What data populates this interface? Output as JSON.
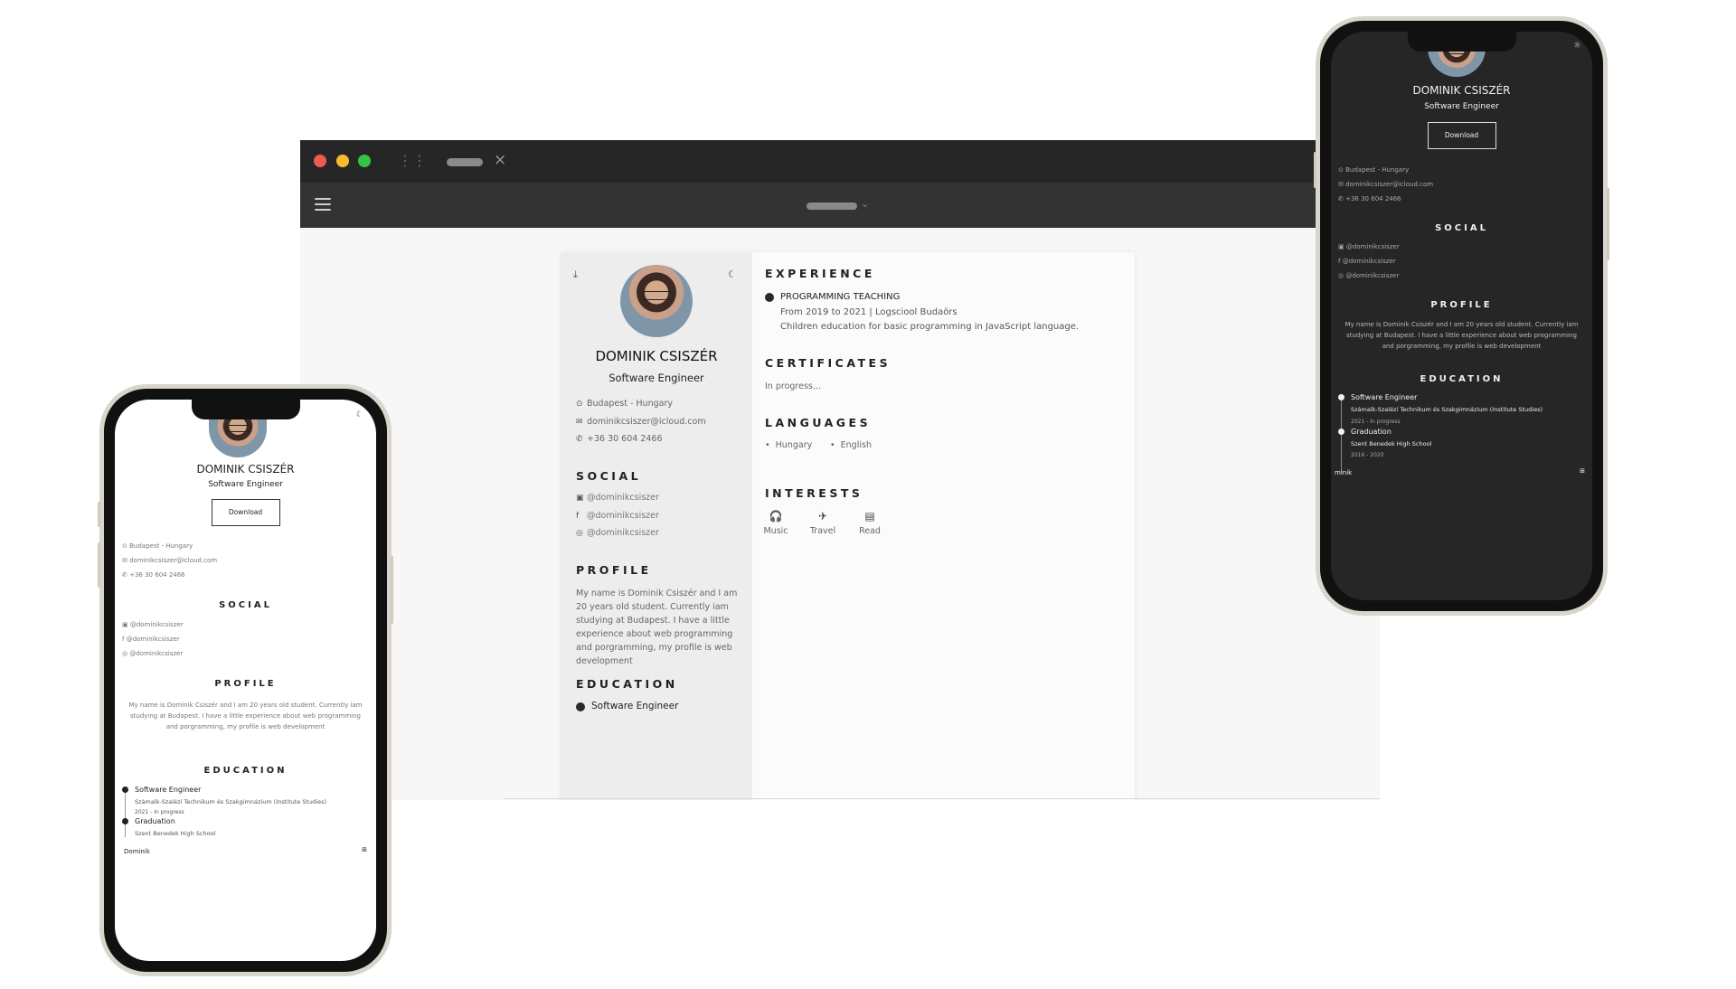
{
  "colors": {
    "titlebar": "#262626",
    "toolbar": "#333333",
    "close": "#ee5a52",
    "minimize": "#f5bd2e",
    "maximize": "#34c548",
    "dark_screen": "#262626",
    "light_screen": "#ffffff"
  },
  "browser": {
    "icons": [
      "close-dot",
      "minimize-dot",
      "maximize-dot",
      "figma-icon",
      "tab-close-icon",
      "menu-icon",
      "chevron-down-icon"
    ],
    "tab_close": "×",
    "url_chevron": "⌄"
  },
  "resume": {
    "name": "DOMINIK CSISZÉR",
    "role": "Software Engineer",
    "download_label": "Download",
    "location": "Budapest - Hungary",
    "email": "dominikcsiszer@icloud.com",
    "phone": "+36 30 604 2466",
    "sections": {
      "social": "SOCIAL",
      "profile": "PROFILE",
      "education": "EDUCATION",
      "experience": "EXPERIENCE",
      "certificates": "CERTIFICATES",
      "languages": "LANGUAGES",
      "interests": "INTERESTS"
    },
    "social": [
      {
        "icon": "linkedin-icon",
        "glyph": "▣",
        "handle": "@dominikcsiszer"
      },
      {
        "icon": "facebook-icon",
        "glyph": "f",
        "handle": "@dominikcsiszer"
      },
      {
        "icon": "instagram-icon",
        "glyph": "◎",
        "handle": "@dominikcsiszer"
      }
    ],
    "profile_text": "My name is Dominik Csiszér and I am 20 years old student. Currently iam studying at Budapest. I have a little experience about web programming and porgramming, my profile is web development",
    "education": [
      {
        "title": "Software Engineer",
        "school": "Számalk-Szalézi Technikum és Szakgimnázium (Institute Studies)",
        "dates": "2021 - In progress"
      },
      {
        "title": "Graduation",
        "school": "Szent Benedek High School",
        "dates": "2016 - 2020"
      }
    ],
    "experience": {
      "title": "PROGRAMMING TEACHING",
      "meta": "From 2019 to 2021 | Logsciool Budaörs",
      "desc": "Children education for basic programming in JavaScript language."
    },
    "certificates_text": "In progress...",
    "languages": [
      "Hungary",
      "English"
    ],
    "interests": [
      {
        "icon": "headphones-icon",
        "glyph": "🎧",
        "label": "Music"
      },
      {
        "icon": "airplane-icon",
        "glyph": "✈",
        "label": "Travel"
      },
      {
        "icon": "book-icon",
        "glyph": "▤",
        "label": "Read"
      }
    ],
    "icons": {
      "download": "⤓",
      "theme": "☾",
      "sun": "☼",
      "location": "⊙",
      "email": "✉",
      "phone": "✆"
    }
  },
  "phone_light": {
    "bottom_label": "Dominik",
    "bottom_icon": "⊞"
  },
  "phone_dark": {
    "bottom_label": "minik",
    "bottom_icon": "⊞"
  }
}
